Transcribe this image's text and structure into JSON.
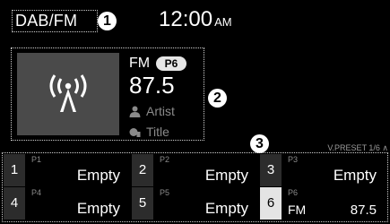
{
  "status_bar": {
    "mode": "DAB/FM",
    "time": "12:00",
    "ampm": "AM"
  },
  "callouts": [
    "1",
    "2",
    "3"
  ],
  "now_playing": {
    "band": "FM",
    "preset_badge": "P6",
    "frequency": "87.5",
    "artist": "Artist",
    "title": "Title",
    "art_icon": "radio-antenna-icon"
  },
  "presets": {
    "page_indicator": "V.PRESET 1/6 ∧",
    "items": [
      {
        "number": "1",
        "label": "P1",
        "value": "Empty"
      },
      {
        "number": "2",
        "label": "P2",
        "value": "Empty"
      },
      {
        "number": "3",
        "label": "P3",
        "value": "Empty"
      },
      {
        "number": "4",
        "label": "P4",
        "value": "Empty"
      },
      {
        "number": "5",
        "label": "P5",
        "value": "Empty"
      },
      {
        "number": "6",
        "label": "P6",
        "band": "FM",
        "value": "87.5",
        "active": true
      }
    ]
  },
  "colors": {
    "background": "#000000",
    "tile": "#2c2c2c",
    "active_tile": "#e4e4e4",
    "muted_text": "#8a8a8a"
  }
}
